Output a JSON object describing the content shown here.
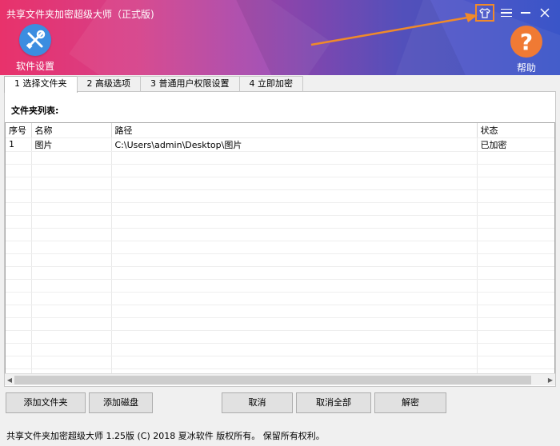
{
  "app": {
    "title": "共享文件夹加密超级大师（正式版)"
  },
  "header": {
    "settings_label": "软件设置",
    "help_label": "帮助",
    "colors": {
      "settings": "#3c8de0",
      "help": "#f07a34",
      "highlight": "#f08a2a"
    }
  },
  "tabs": [
    {
      "label": "1 选择文件夹",
      "active": true
    },
    {
      "label": "2 高级选项",
      "active": false
    },
    {
      "label": "3 普通用户权限设置",
      "active": false
    },
    {
      "label": "4 立即加密",
      "active": false
    }
  ],
  "folder_list": {
    "label": "文件夹列表:",
    "columns": [
      "序号",
      "名称",
      "路径",
      "状态"
    ],
    "rows": [
      [
        "1",
        "图片",
        "C:\\Users\\admin\\Desktop\\图片",
        "已加密"
      ]
    ]
  },
  "buttons": {
    "add_folder": "添加文件夹",
    "add_disk": "添加磁盘",
    "cancel": "取消",
    "cancel_all": "取消全部",
    "decrypt": "解密"
  },
  "status_bar": "共享文件夹加密超级大师 1.25版 (C) 2018 夏冰软件 版权所有。 保留所有权利。"
}
